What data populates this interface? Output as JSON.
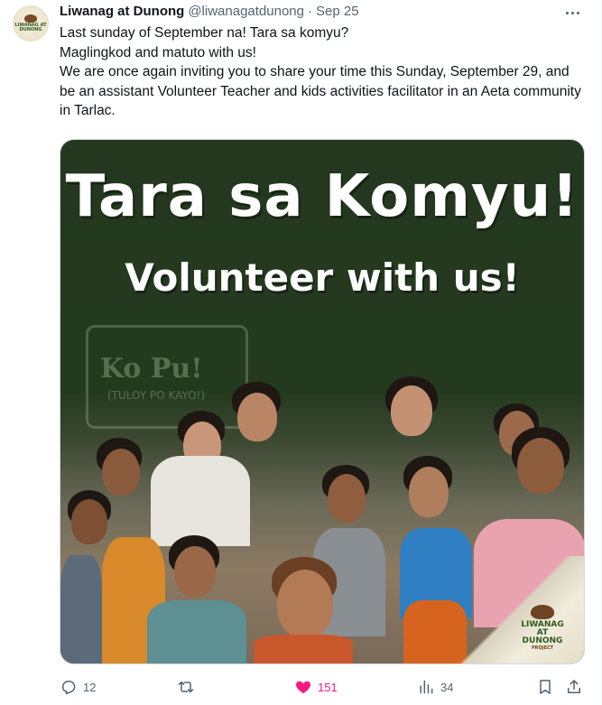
{
  "author": {
    "display_name": "Liwanag at Dunong",
    "handle": "@liwanagatdunong",
    "separator": "·",
    "date": "Sep 25",
    "avatar_logo_text": "LIWANAG AT DUNONG"
  },
  "tweet": {
    "lines": [
      "Last sunday of September na! Tara sa komyu?",
      "Maglingkod and matuto with us!",
      "We are once again inviting you to share your time this Sunday, September 29, and be an assistant Volunteer Teacher and kids activities facilitator in an Aeta community in Tarlac."
    ]
  },
  "media": {
    "headline": "Tara sa Komyu!",
    "subheadline": "Volunteer with us!",
    "background_sign_text": "Ko Pu!",
    "background_sign_subtext": "(TULOY PO KAYO!)",
    "corner_logo": {
      "line1": "LIWANAG",
      "line2": "AT DUNONG",
      "line3": "PROJECT"
    },
    "colors": {
      "banner_green": "#23381e",
      "title_text": "#ffffff"
    }
  },
  "actions": {
    "reply": {
      "icon": "reply-icon",
      "count": "12"
    },
    "repost": {
      "icon": "repost-icon",
      "count": ""
    },
    "like": {
      "icon": "heart-icon",
      "count": "151",
      "liked": true,
      "color": "#f91880"
    },
    "views": {
      "icon": "views-icon",
      "count": "34"
    },
    "bookmark": {
      "icon": "bookmark-icon"
    },
    "share": {
      "icon": "share-icon"
    }
  },
  "theme": {
    "text_primary": "#0f1419",
    "text_secondary": "#536471",
    "like_pink": "#f91880"
  }
}
